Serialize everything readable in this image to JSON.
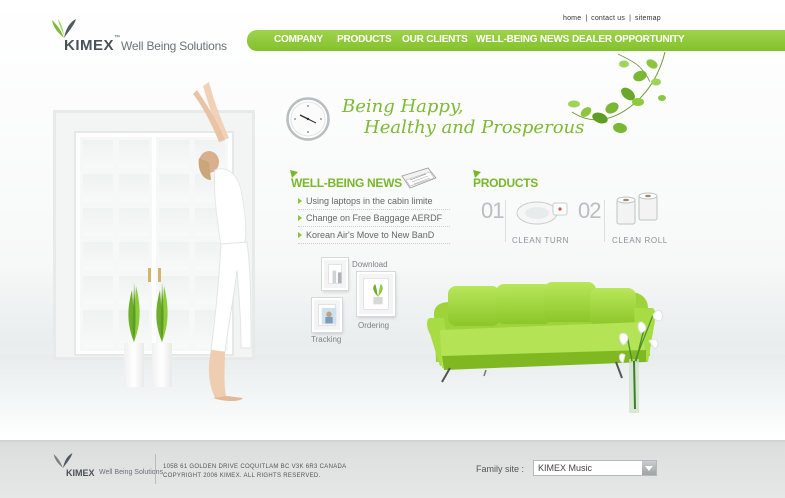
{
  "brand": {
    "name": "KIMEX",
    "tm": "™",
    "tagline": "Well Being Solutions"
  },
  "util_links": [
    "HOME",
    "CONTACT US",
    "SITEMAP"
  ],
  "nav": {
    "items": [
      "COMPANY",
      "PRODUCTS",
      "OUR CLIENTS",
      "WELL-BEING NEWS",
      "DEALER OPPORTUNITY"
    ]
  },
  "slogan": {
    "line1": "Being Happy,",
    "line2": "Healthy and Prosperous"
  },
  "news": {
    "title": "WELL-BEING NEWS",
    "items": [
      "Using laptops in the cabin limite",
      "Change on Free Baggage AERDF",
      "Korean Air's Move to New BanD"
    ]
  },
  "products": {
    "title": "PRODUCTS",
    "items": [
      {
        "num": "01",
        "label": "CLEAN TURN"
      },
      {
        "num": "02",
        "label": "CLEAN ROLL"
      }
    ]
  },
  "quick_links": {
    "download": "Download",
    "ordering": "Ordering",
    "tracking": "Tracking"
  },
  "footer": {
    "logo_name": "KIMEX",
    "logo_tagline": "Well Being Solutions",
    "address": "105B 61 GOLDEN DRIVE COQUITLAM BC V3K 6R3 CANADA",
    "copyright": "COPYRIGHT 2006 KIMEX. ALL RIGHTS RESERVED.",
    "family_label": "Family site :",
    "family_value": "KIMEX Music"
  },
  "colors": {
    "accent": "#84c12d",
    "accent_text": "#78b82a",
    "slogan": "#7dba35"
  }
}
